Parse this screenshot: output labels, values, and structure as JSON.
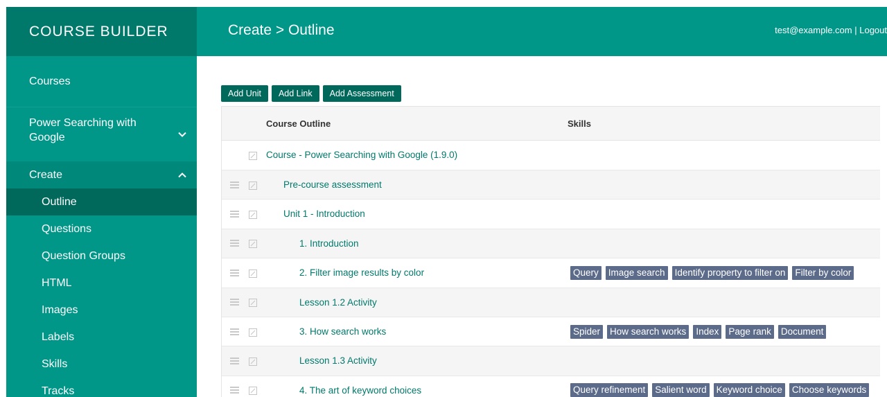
{
  "brand": "COURSE BUILDER",
  "header": {
    "title": "Create > Outline",
    "user_email": "test@example.com",
    "separator": " | ",
    "logout": "Logout"
  },
  "sidebar": {
    "courses": "Courses",
    "course_name": "Power Searching with Google",
    "create": "Create",
    "sub_items": [
      "Outline",
      "Questions",
      "Question Groups",
      "HTML",
      "Images",
      "Labels",
      "Skills",
      "Tracks"
    ]
  },
  "toolbar": {
    "add_unit": "Add Unit",
    "add_link": "Add Link",
    "add_assessment": "Add Assessment"
  },
  "table": {
    "col_outline": "Course Outline",
    "col_skills": "Skills",
    "course_row": "Course - Power Searching with Google (1.9.0)",
    "rows": [
      {
        "title": "Pre-course assessment",
        "skills": []
      },
      {
        "title": "Unit 1 - Introduction",
        "skills": []
      },
      {
        "title": "1. Introduction",
        "skills": []
      },
      {
        "title": "2. Filter image results by color",
        "skills": [
          "Query",
          "Image search",
          "Identify property to filter on",
          "Filter by color"
        ]
      },
      {
        "title": "Lesson 1.2 Activity",
        "skills": []
      },
      {
        "title": "3. How search works",
        "skills": [
          "Spider",
          "How search works",
          "Index",
          "Page rank",
          "Document"
        ]
      },
      {
        "title": "Lesson 1.3 Activity",
        "skills": []
      },
      {
        "title": "4. The art of keyword choices",
        "skills": [
          "Query refinement",
          "Salient word",
          "Keyword choice",
          "Choose keywords"
        ]
      }
    ]
  },
  "colors": {
    "primary": "#009688",
    "primary_dark": "#00796b",
    "active": "#00695c",
    "skill_tag": "#5c6b8a",
    "link": "#00796b"
  },
  "icons": {
    "drag": "drag-handle-icon",
    "edit": "edit-icon",
    "expand": "chevron-down-icon",
    "collapse": "chevron-up-icon"
  }
}
